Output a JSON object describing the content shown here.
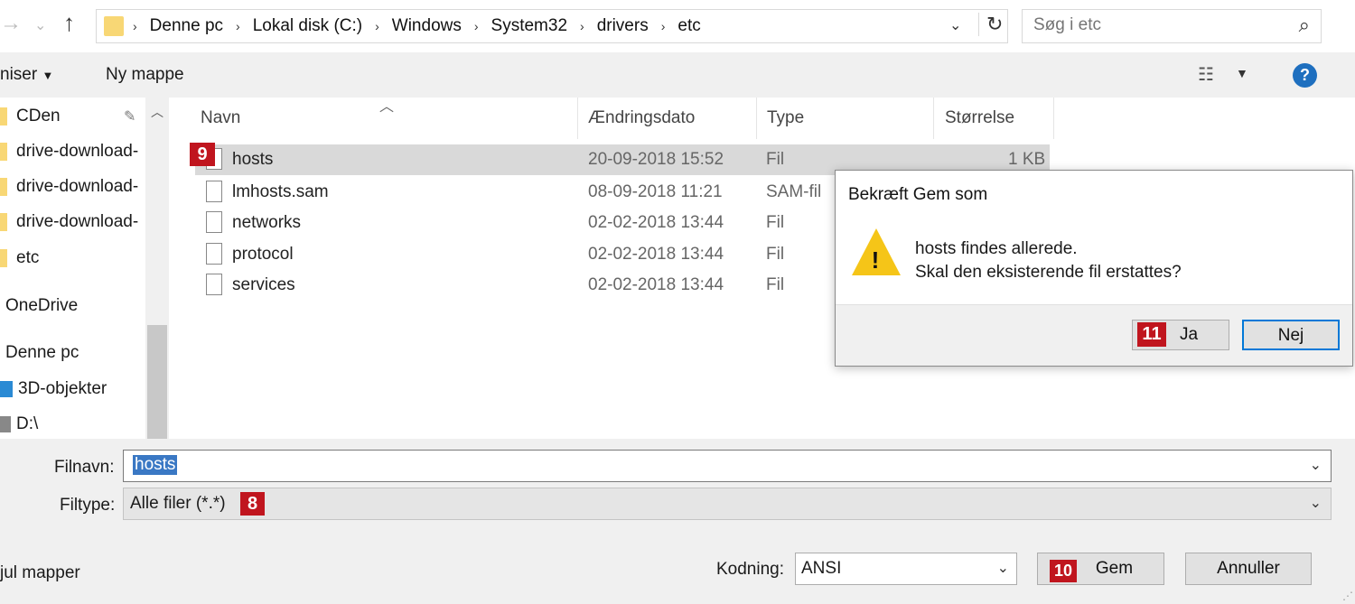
{
  "address": {
    "crumbs": [
      "Denne pc",
      "Lokal disk (C:)",
      "Windows",
      "System32",
      "drivers",
      "etc"
    ],
    "search_placeholder": "Søg i etc"
  },
  "toolbar": {
    "organize_label": "niser",
    "new_folder_label": "Ny mappe",
    "help_label": "?"
  },
  "nav": {
    "items": [
      "CDen",
      "drive-download-",
      "drive-download-",
      "drive-download-",
      "etc",
      "OneDrive",
      "Denne pc",
      "3D-objekter",
      "D:\\"
    ]
  },
  "columns": {
    "name": "Navn",
    "modified": "Ændringsdato",
    "type": "Type",
    "size": "Størrelse"
  },
  "files": [
    {
      "name": "hosts",
      "date": "20-09-2018 15:52",
      "type": "Fil",
      "size": "1 KB"
    },
    {
      "name": "lmhosts.sam",
      "date": "08-09-2018 11:21",
      "type": "SAM-fil",
      "size": ""
    },
    {
      "name": "networks",
      "date": "02-02-2018 13:44",
      "type": "Fil",
      "size": ""
    },
    {
      "name": "protocol",
      "date": "02-02-2018 13:44",
      "type": "Fil",
      "size": ""
    },
    {
      "name": "services",
      "date": "02-02-2018 13:44",
      "type": "Fil",
      "size": ""
    }
  ],
  "badges": {
    "b8": "8",
    "b9": "9",
    "b10": "10",
    "b11": "11"
  },
  "dialog": {
    "title": "Bekræft Gem som",
    "line1": "hosts findes allerede.",
    "line2": "Skal den eksisterende fil erstattes?",
    "yes_label": "Ja",
    "no_label": "Nej"
  },
  "form": {
    "filename_label": "Filnavn:",
    "filename_value": "hosts",
    "filetype_label": "Filtype:",
    "filetype_value": "Alle filer (*.*)",
    "hide_folders_label": "jul mapper",
    "encoding_label": "Kodning:",
    "encoding_value": "ANSI",
    "save_label": "Gem",
    "cancel_label": "Annuller"
  },
  "colors": {
    "badge": "#c0151e",
    "selection": "#3a78c4",
    "accent": "#0078d7"
  }
}
